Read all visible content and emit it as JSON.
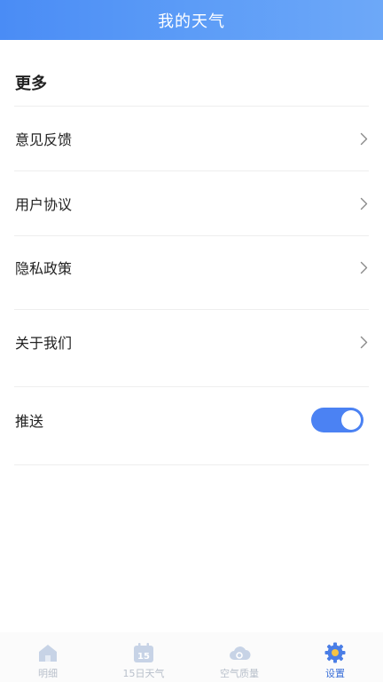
{
  "header": {
    "title": "我的天气"
  },
  "section": {
    "title": "更多"
  },
  "rows": [
    {
      "label": "意见反馈"
    },
    {
      "label": "用户协议"
    },
    {
      "label": "隐私政策"
    },
    {
      "label": "关于我们"
    }
  ],
  "push": {
    "label": "推送",
    "enabled": true
  },
  "nav": [
    {
      "label": "明细",
      "icon": "home-icon",
      "active": false
    },
    {
      "label": "15日天气",
      "icon": "calendar-15-icon",
      "active": false
    },
    {
      "label": "空气质量",
      "icon": "cloud-air-icon",
      "active": false
    },
    {
      "label": "设置",
      "icon": "gear-icon",
      "active": true
    }
  ],
  "colors": {
    "accent": "#4b82f3",
    "header_gradient_start": "#4a8cf5",
    "header_gradient_end": "#6da8f8",
    "nav_inactive": "#b9c0cb",
    "nav_active": "#3a6fd8"
  }
}
